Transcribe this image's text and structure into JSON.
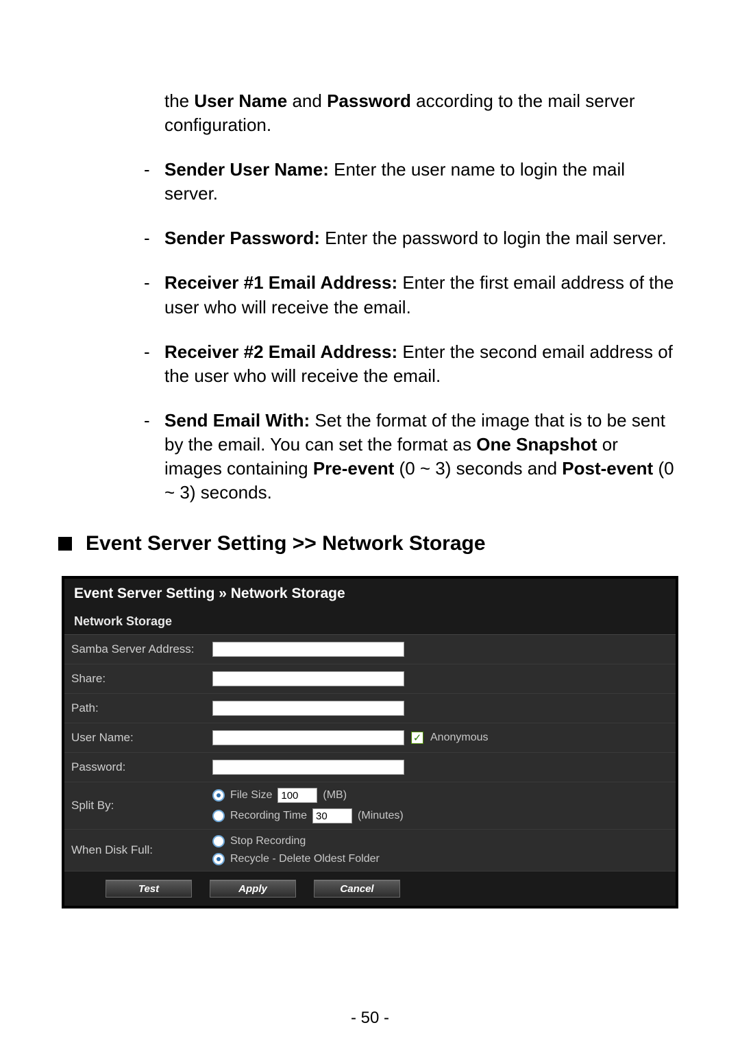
{
  "intro": {
    "pre": "the ",
    "b1": "User Name",
    "mid1": " and ",
    "b2": "Password",
    "post": " according to the mail server configuration."
  },
  "bullets": [
    {
      "bold": "Sender User Name:",
      "text": " Enter the user name to login the mail server."
    },
    {
      "bold": "Sender Password:",
      "text": " Enter the password to login the mail server."
    },
    {
      "bold": "Receiver #1 Email Address:",
      "text": " Enter the first email address of the user who will receive the email."
    },
    {
      "bold": "Receiver #2 Email Address:",
      "text": " Enter the second email address of the user who will receive the email."
    }
  ],
  "send_email": {
    "bold1": "Send Email With:",
    "t1": " Set the format of the image that is to be sent by the email. You can set the format as ",
    "bold2": "One Snapshot",
    "t2": " or images containing ",
    "bold3": "Pre-event",
    "t3": " (0 ~ 3) seconds and ",
    "bold4": "Post-event",
    "t4": " (0 ~ 3) seconds."
  },
  "section_title": "Event Server Setting >> Network Storage",
  "panel": {
    "title": "Event Server Setting » Network Storage",
    "section": "Network Storage",
    "rows": {
      "samba": "Samba Server Address:",
      "share": "Share:",
      "path": "Path:",
      "user": "User Name:",
      "anonymous": "Anonymous",
      "password": "Password:",
      "split": "Split By:",
      "file_size_label": "File Size",
      "file_size_value": "100",
      "file_size_unit": "(MB)",
      "rec_time_label": "Recording Time",
      "rec_time_value": "30",
      "rec_time_unit": "(Minutes)",
      "disk_full": "When Disk Full:",
      "stop_rec": "Stop Recording",
      "recycle": "Recycle - Delete Oldest Folder"
    },
    "buttons": {
      "test": "Test",
      "apply": "Apply",
      "cancel": "Cancel"
    }
  },
  "page_number": "- 50 -"
}
